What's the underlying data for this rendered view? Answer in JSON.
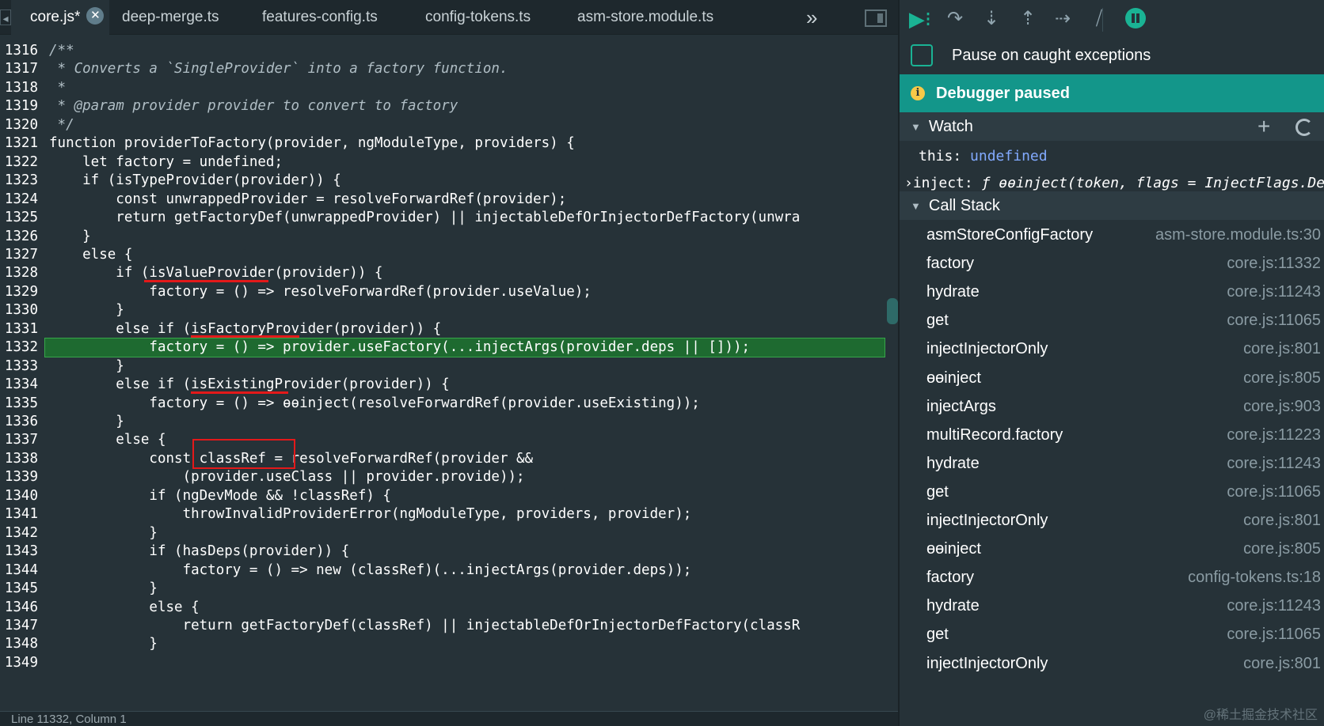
{
  "tabs": [
    {
      "label": "core.js*",
      "active": true
    },
    {
      "label": "deep-merge.ts"
    },
    {
      "label": "features-config.ts"
    },
    {
      "label": "config-tokens.ts"
    },
    {
      "label": "asm-store.module.ts"
    }
  ],
  "tab_more": "»",
  "code_lines": [
    {
      "n": "1316",
      "text": "/**",
      "cls": "cm"
    },
    {
      "n": "1317",
      "text": " * Converts a `SingleProvider` into a factory function.",
      "cls": "cm"
    },
    {
      "n": "1318",
      "text": " *",
      "cls": "cm"
    },
    {
      "n": "1319",
      "text": " * @param provider provider to convert to factory",
      "cls": "cm"
    },
    {
      "n": "1320",
      "text": " */",
      "cls": "cm"
    },
    {
      "n": "1321",
      "text": "function providerToFactory(provider, ngModuleType, providers) {"
    },
    {
      "n": "1322",
      "text": "    let factory = undefined;"
    },
    {
      "n": "1323",
      "text": "    if (isTypeProvider(provider)) {"
    },
    {
      "n": "1324",
      "text": "        const unwrappedProvider = resolveForwardRef(provider);"
    },
    {
      "n": "1325",
      "text": "        return getFactoryDef(unwrappedProvider) || injectableDefOrInjectorDefFactory(unwra"
    },
    {
      "n": "1326",
      "text": "    }"
    },
    {
      "n": "1327",
      "text": "    else {"
    },
    {
      "n": "1328",
      "text": "        if (isValueProvider(provider)) {"
    },
    {
      "n": "1329",
      "text": "            factory = () => resolveForwardRef(provider.useValue);"
    },
    {
      "n": "1330",
      "text": "        }"
    },
    {
      "n": "1331",
      "text": "        else if (isFactoryProvider(provider)) {"
    },
    {
      "n": "1332",
      "text": "            factory = () => provider.useFactory(...injectArgs(provider.deps || []));",
      "current": true
    },
    {
      "n": "1333",
      "text": "        }"
    },
    {
      "n": "1334",
      "text": "        else if (isExistingProvider(provider)) {"
    },
    {
      "n": "1335",
      "text": "            factory = () => ɵɵinject(resolveForwardRef(provider.useExisting));"
    },
    {
      "n": "1336",
      "text": "        }"
    },
    {
      "n": "1337",
      "text": "        else {"
    },
    {
      "n": "1338",
      "text": "            const classRef = resolveForwardRef(provider &&"
    },
    {
      "n": "1339",
      "text": "                (provider.useClass || provider.provide));"
    },
    {
      "n": "1340",
      "text": "            if (ngDevMode && !classRef) {"
    },
    {
      "n": "1341",
      "text": "                throwInvalidProviderError(ngModuleType, providers, provider);"
    },
    {
      "n": "1342",
      "text": "            }"
    },
    {
      "n": "1343",
      "text": "            if (hasDeps(provider)) {"
    },
    {
      "n": "1344",
      "text": "                factory = () => new (classRef)(...injectArgs(provider.deps));"
    },
    {
      "n": "1345",
      "text": "            }"
    },
    {
      "n": "1346",
      "text": "            else {"
    },
    {
      "n": "1347",
      "text": "                return getFactoryDef(classRef) || injectableDefOrInjectorDefFactory(classR"
    },
    {
      "n": "1348",
      "text": "            }"
    },
    {
      "n": "1349",
      "text": ""
    }
  ],
  "statusbar": "Line 11332, Column 1",
  "debugger": {
    "pause_on_caught_label": "Pause on caught exceptions",
    "paused_label": "Debugger paused",
    "watch_title": "Watch",
    "call_stack_title": "Call Stack",
    "watch": [
      {
        "key": "this",
        "sep": ": ",
        "value": "undefined"
      },
      {
        "key": "inject",
        "sep": ": ",
        "value": "ƒ ɵɵinject(token, flags = InjectFlags.Default)"
      }
    ],
    "call_stack": [
      {
        "name": "asmStoreConfigFactory",
        "loc": "asm-store.module.ts:30"
      },
      {
        "name": "factory",
        "loc": "core.js:11332"
      },
      {
        "name": "hydrate",
        "loc": "core.js:11243"
      },
      {
        "name": "get",
        "loc": "core.js:11065"
      },
      {
        "name": "injectInjectorOnly",
        "loc": "core.js:801"
      },
      {
        "name": "ɵɵinject",
        "loc": "core.js:805"
      },
      {
        "name": "injectArgs",
        "loc": "core.js:903"
      },
      {
        "name": "multiRecord.factory",
        "loc": "core.js:11223"
      },
      {
        "name": "hydrate",
        "loc": "core.js:11243"
      },
      {
        "name": "get",
        "loc": "core.js:11065"
      },
      {
        "name": "injectInjectorOnly",
        "loc": "core.js:801"
      },
      {
        "name": "ɵɵinject",
        "loc": "core.js:805"
      },
      {
        "name": "factory",
        "loc": "config-tokens.ts:18"
      },
      {
        "name": "hydrate",
        "loc": "core.js:11243"
      },
      {
        "name": "get",
        "loc": "core.js:11065"
      },
      {
        "name": "injectInjectorOnly",
        "loc": "core.js:801"
      }
    ]
  },
  "watermark": "@稀土掘金技术社区"
}
